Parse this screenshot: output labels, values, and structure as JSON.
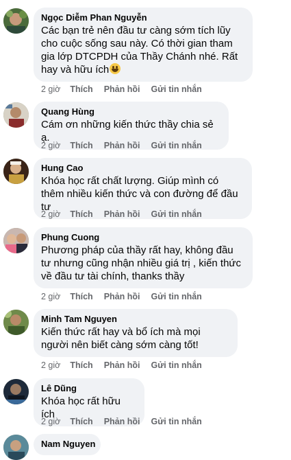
{
  "comments": [
    {
      "name": "Ngọc Diễm Phan Nguyễn",
      "text": "Các bạn trẻ nên đầu tư càng sớm tích lũy cho cuộc sống sau này. Có thời gian tham gia lớp DTCPDH của Thầy Chánh nhé. Rất hay và hữu ích",
      "has_emoji": true,
      "emoji": "smiling-face-icon",
      "time": "2 giờ",
      "like": "Thích",
      "reply": "Phản hồi",
      "message": "Gửi tin nhắn"
    },
    {
      "name": "Quang Hùng",
      "text": "Cám ơn những kiến thức thầy chia sẻ ạ.",
      "time": "2 giờ",
      "like": "Thích",
      "reply": "Phản hồi",
      "message": "Gửi tin nhắn"
    },
    {
      "name": "Hung Cao",
      "text": "Khóa học rất chất lượng. Giúp mình có thêm nhiều kiến thức và con đường để đầu tư",
      "time": "2 giờ",
      "like": "Thích",
      "reply": "Phản hồi",
      "message": "Gửi tin nhắn"
    },
    {
      "name": "Phung Cuong",
      "text": "Phương pháp của thầy rất hay, không đầu tư nhưng cũng nhận nhiều giá trị , kiến thức về đầu tư tài chính, thanks thầy",
      "time": "2 giờ",
      "like": "Thích",
      "reply": "Phản hồi",
      "message": "Gửi tin nhắn"
    },
    {
      "name": "Minh Tam Nguyen",
      "text": "Kiến thức rất hay và bổ ích mà mọi người nên biết càng sớm càng tốt!",
      "time": "2 giờ",
      "like": "Thích",
      "reply": "Phản hồi",
      "message": "Gửi tin nhắn"
    },
    {
      "name": "Lê Dũng",
      "text": "Khóa học rất hữu ích",
      "time": "2 giờ",
      "like": "Thích",
      "reply": "Phản hồi",
      "message": "Gửi tin nhắn"
    },
    {
      "name": "Nam Nguyen",
      "text": "",
      "time": "",
      "like": "",
      "reply": "",
      "message": ""
    }
  ],
  "colors": {
    "bubble": "#f0f2f5",
    "name": "#050505",
    "meta": "#65676b",
    "emoji": "#f7c948"
  }
}
